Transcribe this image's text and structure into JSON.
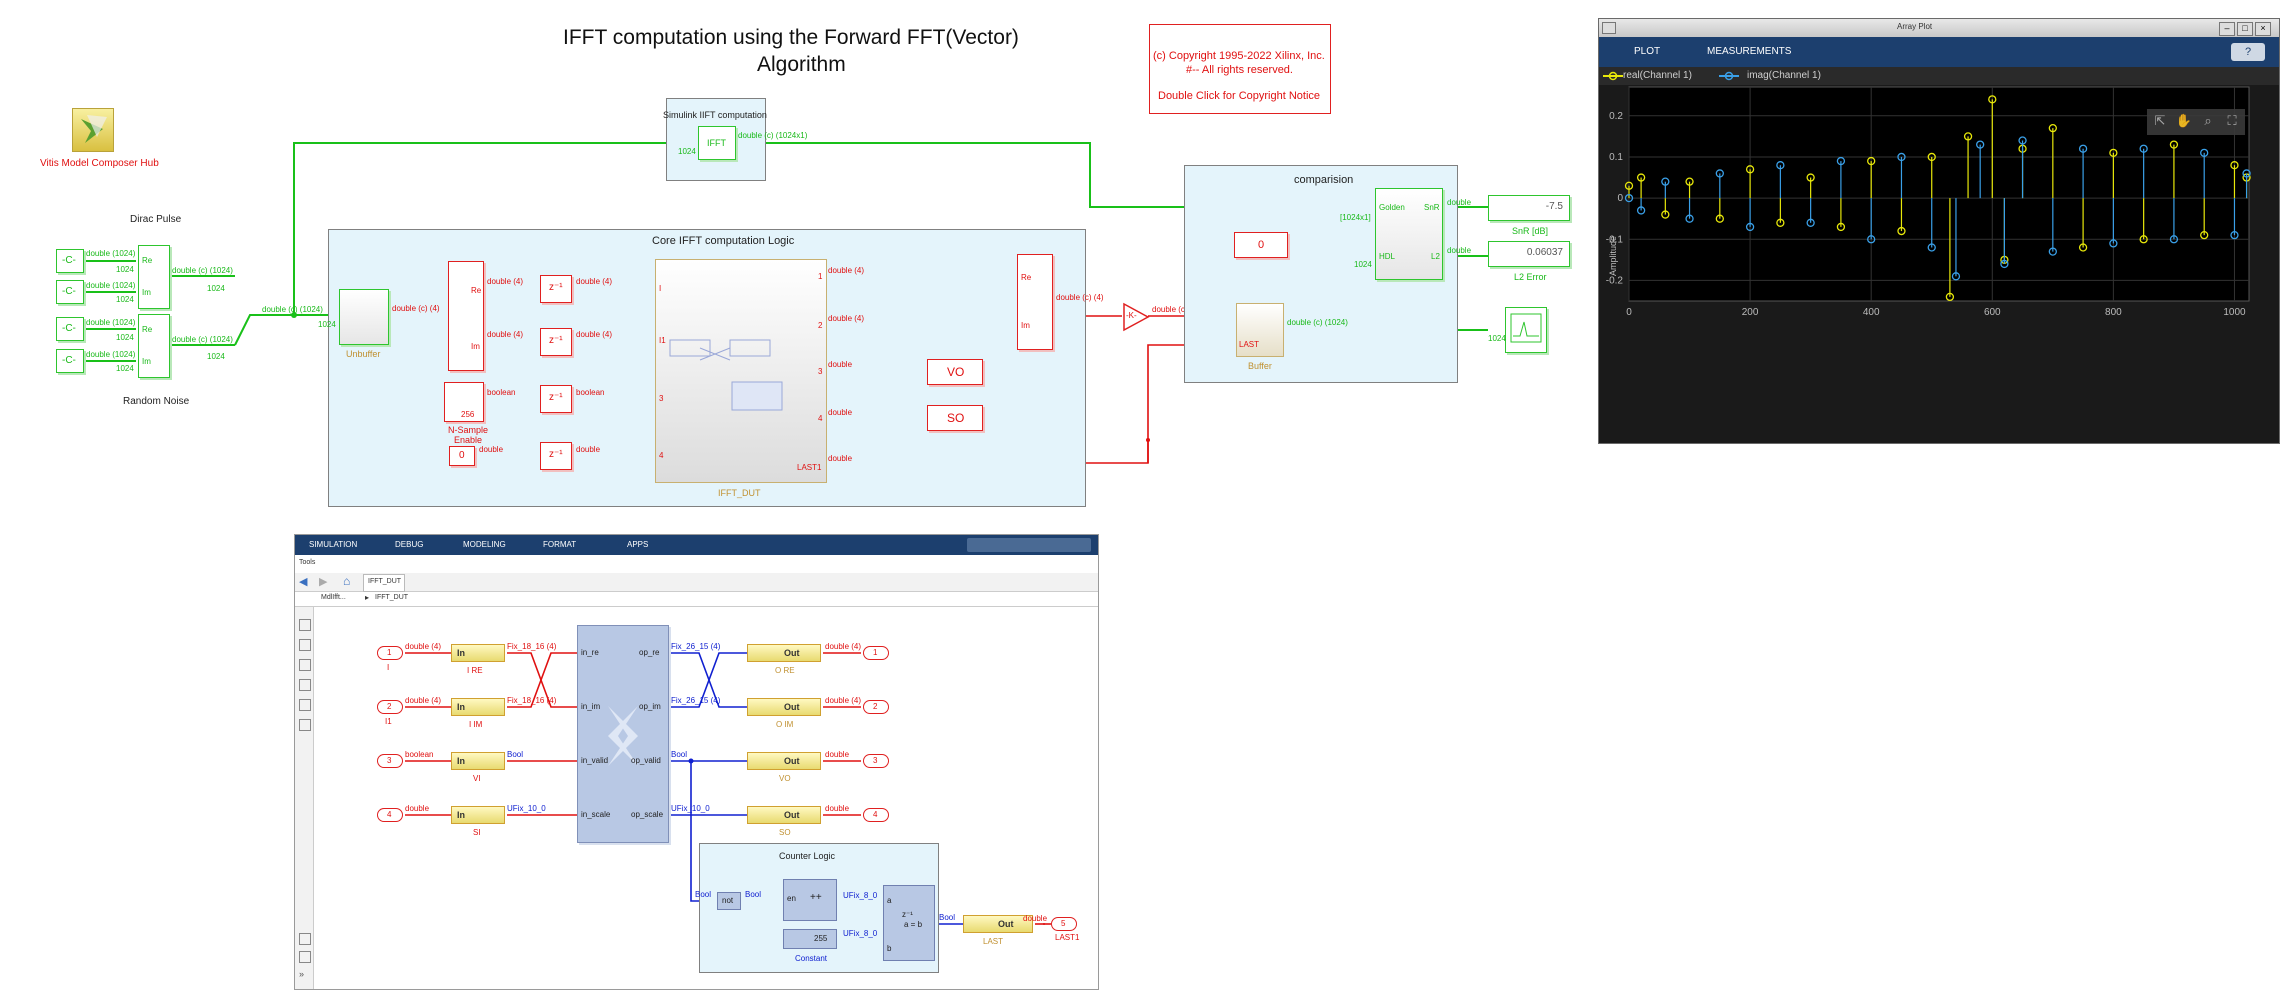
{
  "model": {
    "title": "IFFT computation using the Forward FFT(Vector) Algorithm",
    "title_line1": "IFFT computation using the Forward FFT(Vector)",
    "title_line2": "Algorithm",
    "copyright": {
      "line1": "(c) Copyright 1995-2022 Xilinx, Inc.",
      "line2": "#-- All rights reserved.",
      "line3": "Double Click for Copyright Notice"
    },
    "hub_label": "Vitis Model Composer Hub",
    "dirac_label": "Dirac Pulse",
    "random_label": "Random Noise",
    "const_label": "-C-",
    "sig_double_1024": "double (1024)",
    "sig_c_1024": "double (c) (1024)",
    "sig_c_1024_short": "double (c) (1024)",
    "sig_1024": "1024",
    "re": "Re",
    "im": "Im",
    "unbuffer_label": "Unbuffer",
    "core_title": "Core IFFT computation Logic",
    "sig_c4": "double (c) (4)",
    "sig_d4": "double (4)",
    "sig_double": "double",
    "sig_boolean": "boolean",
    "zinv": "z⁻¹",
    "nsample_label": "N-Sample Enable",
    "nsample_val": "256",
    "zero": "0",
    "dut_label": "IFFT_DUT",
    "dut_ports_in": [
      "I",
      "I1",
      "3",
      "4"
    ],
    "dut_ports_out": [
      "1",
      "2",
      "3",
      "4"
    ],
    "last1": "LAST1",
    "vo": "VO",
    "so": "SO",
    "simulink_title": "Simulink IIFT computation",
    "ifft": "IFFT",
    "sig_c_1024x1": "double (c) (1024x1)",
    "comparision_title": "comparision",
    "gain": "-K-",
    "zero_block": "0",
    "buffer_label": "Buffer",
    "buffer_last": "LAST",
    "golden": "Golden",
    "hdl": "HDL",
    "snr": "SnR",
    "l2": "L2",
    "snr_val": "-7.5",
    "l2_val": "0.06037",
    "snr_label": "SnR [dB]",
    "l2_label": "L2 Error",
    "sig_1024x1": "[1024x1]"
  },
  "array_plot": {
    "window_title": "Array Plot",
    "tabs": [
      "PLOT",
      "MEASUREMENTS"
    ],
    "legend": [
      "real(Channel 1)",
      "imag(Channel 1)"
    ],
    "ylabel": "Amplitude",
    "yticks": [
      "0.2",
      "0.1",
      "0",
      "-0.1",
      "-0.2"
    ],
    "xticks": [
      "0",
      "200",
      "400",
      "600",
      "800",
      "1000"
    ],
    "colors": {
      "real": "#e8e80a",
      "imag": "#3aa0e8",
      "bg": "#000000",
      "header": "#1c3f6e"
    }
  },
  "chart_data": {
    "type": "scatter",
    "title": "",
    "xlabel": "",
    "ylabel": "Amplitude",
    "xlim": [
      0,
      1024
    ],
    "ylim": [
      -0.25,
      0.27
    ],
    "grid": true,
    "legend_position": "top-left",
    "series": [
      {
        "name": "real(Channel 1)",
        "color": "#e8e80a",
        "x": [
          0,
          20,
          60,
          100,
          150,
          200,
          250,
          300,
          350,
          400,
          450,
          500,
          530,
          560,
          600,
          620,
          650,
          700,
          750,
          800,
          850,
          900,
          950,
          1000,
          1020
        ],
        "values": [
          0.03,
          0.05,
          -0.04,
          0.04,
          -0.05,
          0.07,
          -0.06,
          0.05,
          -0.07,
          0.09,
          -0.08,
          0.1,
          -0.24,
          0.15,
          0.24,
          -0.15,
          0.12,
          0.17,
          -0.12,
          0.11,
          -0.1,
          0.13,
          -0.09,
          0.08,
          0.05
        ]
      },
      {
        "name": "imag(Channel 1)",
        "color": "#3aa0e8",
        "x": [
          0,
          20,
          60,
          100,
          150,
          200,
          250,
          300,
          350,
          400,
          450,
          500,
          540,
          580,
          620,
          650,
          700,
          750,
          800,
          850,
          900,
          950,
          1000,
          1020
        ],
        "values": [
          0.0,
          -0.03,
          0.04,
          -0.05,
          0.06,
          -0.07,
          0.08,
          -0.06,
          0.09,
          -0.1,
          0.1,
          -0.12,
          -0.19,
          0.13,
          -0.16,
          0.14,
          -0.13,
          0.12,
          -0.11,
          0.12,
          -0.1,
          0.11,
          -0.09,
          0.06
        ]
      }
    ]
  },
  "hdl_window": {
    "menu": [
      "SIMULATION",
      "DEBUG",
      "MODELING",
      "FORMAT",
      "APPS"
    ],
    "tools_label": "Tools",
    "tab": "IFFT_DUT",
    "breadcrumb": [
      "MdlIfft...",
      "IFFT_DUT"
    ],
    "in_ports": [
      {
        "num": "1",
        "name": "I",
        "sig": "double (4)",
        "gw": "In",
        "gwname": "I RE",
        "out": "Fix_18_16 (4)"
      },
      {
        "num": "2",
        "name": "I1",
        "sig": "double (4)",
        "gw": "In",
        "gwname": "I IM",
        "out": "Fix_18_16 (4)"
      },
      {
        "num": "3",
        "name": "",
        "sig": "boolean",
        "gw": "In",
        "gwname": "VI",
        "out": "Bool"
      },
      {
        "num": "4",
        "name": "",
        "sig": "double",
        "gw": "In",
        "gwname": "SI",
        "out": "UFix_10_0"
      }
    ],
    "fft_ports_in": [
      "in_re",
      "in_im",
      "in_valid",
      "in_scale"
    ],
    "fft_ports_out": [
      "op_re",
      "op_im",
      "op_valid",
      "op_scale"
    ],
    "out_ports": [
      {
        "num": "1",
        "sig_in": "Fix_26_15 (4)",
        "gw": "Out",
        "gwname": "O RE",
        "sig": "double (4)"
      },
      {
        "num": "2",
        "sig_in": "Fix_26_15 (4)",
        "gw": "Out",
        "gwname": "O IM",
        "sig": "double (4)"
      },
      {
        "num": "3",
        "sig_in": "Bool",
        "gw": "Out",
        "gwname": "VO",
        "sig": "double"
      },
      {
        "num": "4",
        "sig_in": "UFix_10_0",
        "gw": "Out",
        "gwname": "SO",
        "sig": "double"
      }
    ],
    "counter_title": "Counter Logic",
    "not_label": "not",
    "inc_label": "++",
    "en_label": "en",
    "const_val": "255",
    "const_label": "Constant",
    "ufix8": "UFix_8_0",
    "rel_label": "a = b",
    "rel_a": "a",
    "rel_b": "b",
    "z": "z⁻¹",
    "bool": "Bool",
    "last_gw": "Out",
    "last_name": "LAST",
    "last_port_num": "5",
    "last_port_name": "LAST1",
    "last_sig": "double"
  }
}
